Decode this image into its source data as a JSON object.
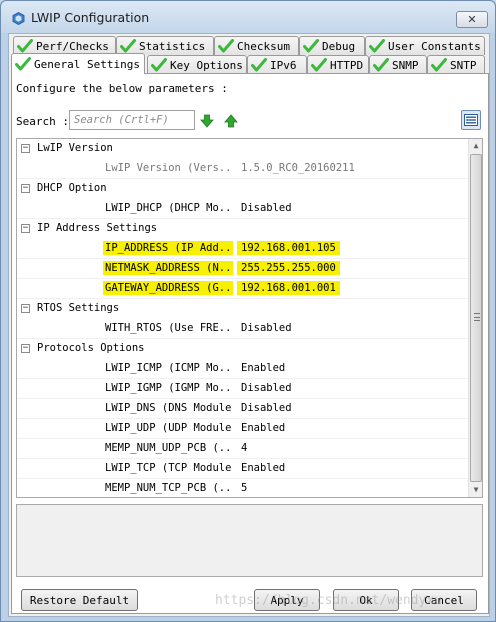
{
  "window": {
    "title": "LWIP Configuration",
    "close_label": "✕"
  },
  "tabs_row1": [
    {
      "label": "Perf/Checks"
    },
    {
      "label": "Statistics"
    },
    {
      "label": "Checksum"
    },
    {
      "label": "Debug"
    },
    {
      "label": "User Constants"
    }
  ],
  "tabs_row2": [
    {
      "label": "General Settings",
      "active": true
    },
    {
      "label": "Key Options"
    },
    {
      "label": "IPv6"
    },
    {
      "label": "HTTPD"
    },
    {
      "label": "SNMP"
    },
    {
      "label": "SNTP"
    }
  ],
  "panel": {
    "info": "Configure the below parameters :",
    "search_label": "Search :",
    "search_placeholder": "Search (Crtl+F)"
  },
  "tree": {
    "groups": [
      {
        "label": "LwIP Version",
        "expander": "−"
      },
      {
        "label": "DHCP Option",
        "expander": "−"
      },
      {
        "label": "IP Address Settings",
        "expander": "−"
      },
      {
        "label": "RTOS Settings",
        "expander": "−"
      },
      {
        "label": "Protocols Options",
        "expander": "−"
      }
    ],
    "params": [
      {
        "name": "LwIP Version (Vers...",
        "value": "1.5.0_RC0_20160211"
      },
      {
        "name": "LWIP_DHCP (DHCP Mo...",
        "value": "Disabled"
      },
      {
        "name": "IP_ADDRESS (IP Add...",
        "value": "192.168.001.105"
      },
      {
        "name": "NETMASK_ADDRESS (N...",
        "value": "255.255.255.000"
      },
      {
        "name": "GATEWAY_ADDRESS (G...",
        "value": "192.168.001.001"
      },
      {
        "name": "WITH_RTOS (Use FRE...",
        "value": "Disabled"
      },
      {
        "name": "LWIP_ICMP (ICMP Mo...",
        "value": "Enabled"
      },
      {
        "name": "LWIP_IGMP (IGMP Mo...",
        "value": "Disabled"
      },
      {
        "name": "LWIP_DNS (DNS Module)",
        "value": "Disabled"
      },
      {
        "name": "LWIP_UDP (UDP Module)",
        "value": "Enabled"
      },
      {
        "name": "MEMP_NUM_UDP_PCB (...",
        "value": "4"
      },
      {
        "name": "LWIP_TCP (TCP Module)",
        "value": "Enabled"
      },
      {
        "name": "MEMP_NUM_TCP_PCB (...",
        "value": "5"
      }
    ],
    "scroll_up": "▲",
    "scroll_down": "▼"
  },
  "buttons": {
    "restore": "Restore Default",
    "apply": "Apply",
    "ok": "Ok",
    "cancel": "Cancel"
  },
  "watermark": "https://blog.csdn.net/wendyxu",
  "colors": {
    "highlight": "#f7f000",
    "check_green": "#3cb83c",
    "arrow_green": "#2fa82f"
  }
}
